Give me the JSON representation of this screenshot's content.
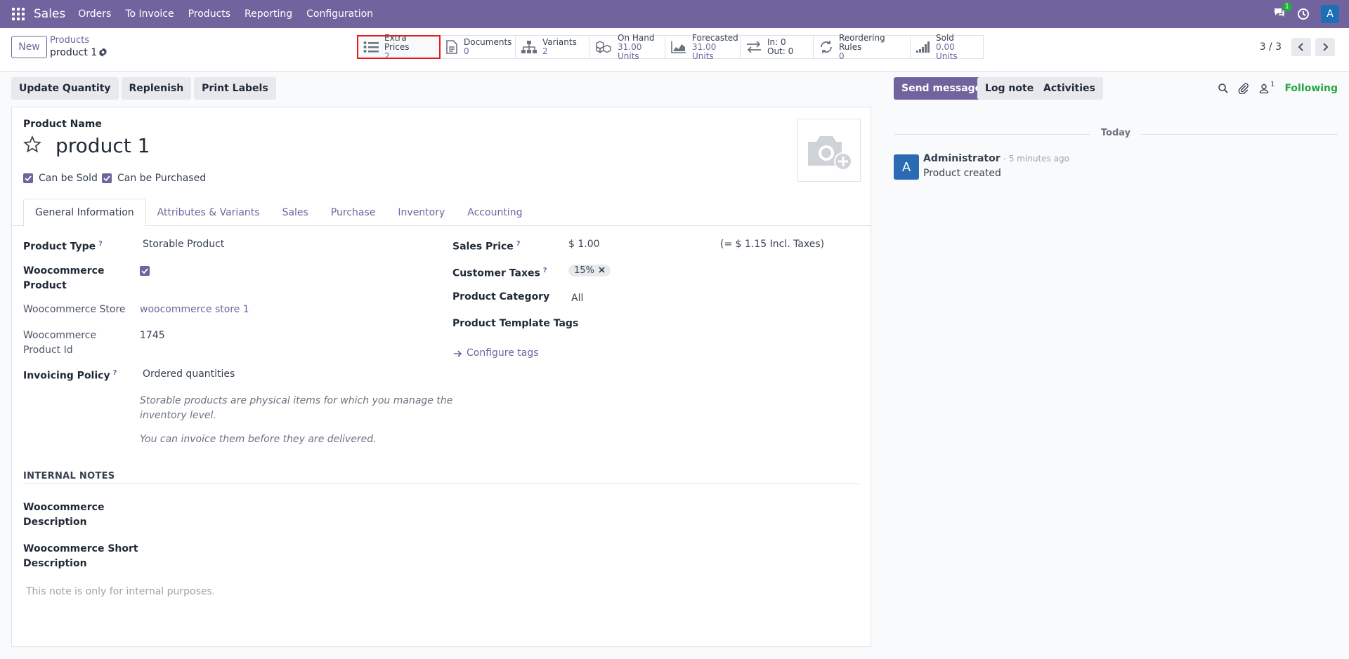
{
  "navbar": {
    "brand": "Sales",
    "menus": [
      "Orders",
      "To Invoice",
      "Products",
      "Reporting",
      "Configuration"
    ],
    "messages_badge": "1",
    "user_initial": "A"
  },
  "control": {
    "new_label": "New",
    "breadcrumb_parent": "Products",
    "breadcrumb_current": "product 1",
    "pager": "3 / 3",
    "stats": [
      {
        "label": "Extra Prices",
        "value": "2"
      },
      {
        "label": "Documents",
        "value": "0"
      },
      {
        "label": "Variants",
        "value": "2"
      },
      {
        "label": "On Hand",
        "value": "31.00 Units"
      },
      {
        "label": "Forecasted",
        "value": "31.00 Units"
      },
      {
        "label": "In: 0",
        "value": "Out: 0"
      },
      {
        "label": "Reordering Rules",
        "value": "0"
      },
      {
        "label": "Sold",
        "value": "0.00 Units"
      }
    ]
  },
  "actions": [
    "Update Quantity",
    "Replenish",
    "Print Labels"
  ],
  "form": {
    "product_name_label": "Product Name",
    "product_name": "product 1",
    "can_be_sold": "Can be Sold",
    "can_be_purchased": "Can be Purchased",
    "tabs": [
      "General Information",
      "Attributes & Variants",
      "Sales",
      "Purchase",
      "Inventory",
      "Accounting"
    ],
    "left": {
      "product_type_label": "Product Type",
      "product_type": "Storable Product",
      "woo_product_label_1": "Woocommerce",
      "woo_product_label_2": "Product",
      "woo_store_label": "Woocommerce Store",
      "woo_store": "woocommerce store 1",
      "woo_id_label_1": "Woocommerce",
      "woo_id_label_2": "Product Id",
      "woo_id": "1745",
      "invoicing_label": "Invoicing Policy",
      "invoicing": "Ordered quantities",
      "hint1_line1": "Storable products are physical items for which you manage the",
      "hint1_line2": "inventory level.",
      "hint2": "You can invoice them before they are delivered."
    },
    "right": {
      "sales_price_label": "Sales Price",
      "sales_price": "$ 1.00",
      "incl_taxes": "(= $ 1.15 Incl. Taxes)",
      "customer_taxes_label": "Customer Taxes",
      "tax_tag": "15%",
      "category_label": "Product Category",
      "category": "All",
      "template_tags_label": "Product Template Tags",
      "configure_tags": "Configure tags"
    },
    "internal_notes_title": "INTERNAL NOTES",
    "woo_desc_label_1": "Woocommerce",
    "woo_desc_label_2": "Description",
    "woo_short_label_1": "Woocommerce Short",
    "woo_short_label_2": "Description",
    "notes_placeholder": "This note is only for internal purposes."
  },
  "chatter": {
    "send_message": "Send message",
    "log_note": "Log note",
    "activities": "Activities",
    "followers_count": "1",
    "following": "Following",
    "today": "Today",
    "message": {
      "author": "Administrator",
      "time": "- 5 minutes ago",
      "body": "Product created",
      "initial": "A"
    }
  },
  "colors": {
    "brand": "#71639e",
    "highlight": "#e41b1b",
    "following": "#28a745"
  }
}
